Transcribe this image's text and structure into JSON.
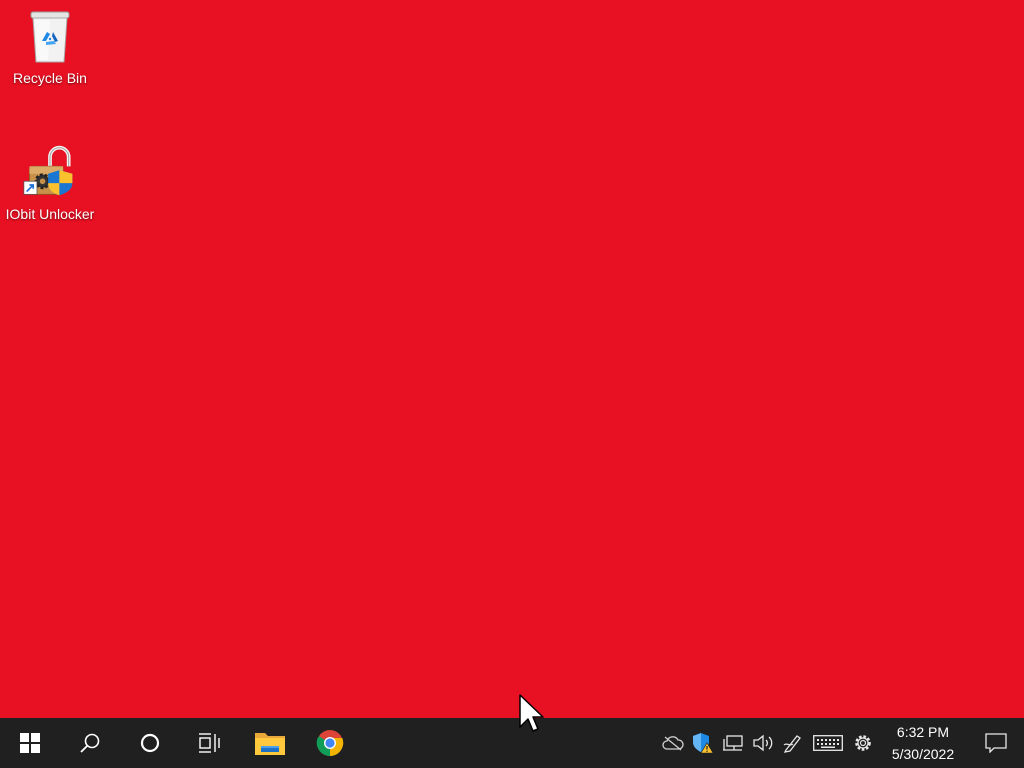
{
  "desktop": {
    "background_color": "#e81123",
    "icons": [
      {
        "label": "Recycle Bin",
        "icon": "recycle-bin-icon"
      },
      {
        "label": "IObit Unlocker",
        "icon": "iobit-unlocker-icon"
      }
    ]
  },
  "taskbar": {
    "background_color": "#202020",
    "items": [
      {
        "name": "start",
        "icon": "windows-start-icon"
      },
      {
        "name": "search",
        "icon": "search-icon"
      },
      {
        "name": "cortana",
        "icon": "cortana-icon"
      },
      {
        "name": "task-view",
        "icon": "task-view-icon"
      },
      {
        "name": "file-explorer",
        "icon": "file-explorer-icon"
      },
      {
        "name": "chrome",
        "icon": "chrome-icon"
      }
    ],
    "tray": {
      "icons": [
        "onedrive-icon",
        "security-warning-icon",
        "network-icon",
        "volume-icon",
        "pen-icon",
        "keyboard-icon",
        "settings-gear-icon"
      ],
      "time": "6:32 PM",
      "date": "5/30/2022",
      "notification_icon": "action-center-icon"
    }
  }
}
